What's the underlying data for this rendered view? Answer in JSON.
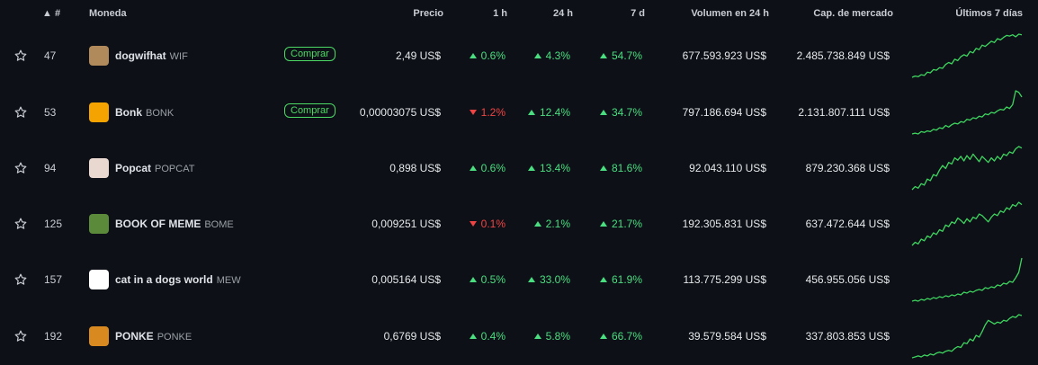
{
  "headers": {
    "rank": "▲ #",
    "coin": "Moneda",
    "price": "Precio",
    "h1": "1 h",
    "h24": "24 h",
    "d7": "7 d",
    "volume": "Volumen en 24 h",
    "mcap": "Cap. de mercado",
    "last7": "Últimos 7 días"
  },
  "rows": [
    {
      "rank": "47",
      "name": "dogwifhat",
      "symbol": "WIF",
      "buy": "Comprar",
      "price": "2,49 US$",
      "h1": "0.6%",
      "h1_dir": "up",
      "h24": "4.3%",
      "h24_dir": "up",
      "d7": "54.7%",
      "d7_dir": "up",
      "volume": "677.593.923 US$",
      "mcap": "2.485.738.849 US$",
      "logo_color": "#b08a5a",
      "icon": "dog-logo-icon",
      "spark": [
        10,
        12,
        11,
        14,
        13,
        18,
        17,
        22,
        21,
        25,
        24,
        30,
        33,
        31,
        38,
        36,
        42,
        45,
        43,
        50,
        48,
        55,
        53,
        60,
        58,
        62,
        66,
        64,
        70,
        68,
        72,
        75,
        74,
        76,
        73,
        77,
        76
      ]
    },
    {
      "rank": "53",
      "name": "Bonk",
      "symbol": "BONK",
      "buy": "Comprar",
      "price": "0,00003075 US$",
      "h1": "1.2%",
      "h1_dir": "down",
      "h24": "12.4%",
      "h24_dir": "up",
      "d7": "34.7%",
      "d7_dir": "up",
      "volume": "797.186.694 US$",
      "mcap": "2.131.807.111 US$",
      "logo_color": "#f4a300",
      "icon": "bonk-logo-icon",
      "spark": [
        12,
        13,
        12,
        15,
        14,
        16,
        15,
        18,
        17,
        20,
        19,
        23,
        21,
        24,
        26,
        25,
        28,
        27,
        31,
        30,
        33,
        32,
        35,
        34,
        38,
        37,
        40,
        39,
        42,
        44,
        43,
        47,
        45,
        50,
        68,
        66,
        60
      ]
    },
    {
      "rank": "94",
      "name": "Popcat",
      "symbol": "POPCAT",
      "buy": "",
      "price": "0,898 US$",
      "h1": "0.6%",
      "h1_dir": "up",
      "h24": "13.4%",
      "h24_dir": "up",
      "d7": "81.6%",
      "d7_dir": "up",
      "volume": "92.043.110 US$",
      "mcap": "879.230.368 US$",
      "logo_color": "#e8d8d0",
      "icon": "popcat-logo-icon",
      "spark": [
        8,
        12,
        10,
        16,
        14,
        22,
        20,
        28,
        26,
        34,
        40,
        36,
        44,
        42,
        50,
        47,
        52,
        46,
        53,
        48,
        55,
        50,
        45,
        52,
        48,
        44,
        50,
        46,
        52,
        48,
        55,
        53,
        58,
        56,
        62,
        65,
        63
      ]
    },
    {
      "rank": "125",
      "name": "BOOK OF MEME",
      "symbol": "BOME",
      "buy": "",
      "price": "0,009251 US$",
      "h1": "0.1%",
      "h1_dir": "down",
      "h24": "2.1%",
      "h24_dir": "up",
      "d7": "21.7%",
      "d7_dir": "up",
      "volume": "192.305.831 US$",
      "mcap": "637.472.644 US$",
      "logo_color": "#5a8a3a",
      "icon": "pepe-logo-icon",
      "spark": [
        10,
        14,
        12,
        18,
        16,
        22,
        20,
        26,
        24,
        30,
        28,
        36,
        34,
        40,
        38,
        45,
        42,
        38,
        44,
        40,
        46,
        44,
        50,
        48,
        44,
        40,
        46,
        50,
        48,
        54,
        52,
        58,
        56,
        62,
        60,
        65,
        62
      ]
    },
    {
      "rank": "157",
      "name": "cat in a dogs world",
      "symbol": "MEW",
      "buy": "",
      "price": "0,005164 US$",
      "h1": "0.5%",
      "h1_dir": "up",
      "h24": "33.0%",
      "h24_dir": "up",
      "d7": "61.9%",
      "d7_dir": "up",
      "volume": "113.775.299 US$",
      "mcap": "456.955.056 US$",
      "logo_color": "#ffffff",
      "icon": "cat-logo-icon",
      "spark": [
        10,
        11,
        10,
        12,
        11,
        13,
        12,
        14,
        13,
        15,
        14,
        16,
        15,
        17,
        16,
        18,
        17,
        20,
        19,
        21,
        20,
        22,
        23,
        22,
        25,
        24,
        26,
        25,
        28,
        27,
        30,
        29,
        32,
        31,
        36,
        42,
        58
      ]
    },
    {
      "rank": "192",
      "name": "PONKE",
      "symbol": "PONKE",
      "buy": "",
      "price": "0,6769 US$",
      "h1": "0.4%",
      "h1_dir": "up",
      "h24": "5.8%",
      "h24_dir": "up",
      "d7": "66.7%",
      "d7_dir": "up",
      "volume": "39.579.584 US$",
      "mcap": "337.803.853 US$",
      "logo_color": "#d88a20",
      "icon": "ponke-logo-icon",
      "spark": [
        10,
        11,
        12,
        11,
        13,
        12,
        14,
        13,
        15,
        16,
        15,
        17,
        18,
        17,
        20,
        22,
        21,
        26,
        25,
        30,
        28,
        34,
        32,
        38,
        45,
        50,
        48,
        46,
        48,
        47,
        50,
        49,
        52,
        54,
        53,
        56,
        55
      ]
    }
  ],
  "colors": {
    "up": "#4ade80",
    "down": "#f04444",
    "spark": "#3fd45f",
    "background": "#0d1117"
  }
}
